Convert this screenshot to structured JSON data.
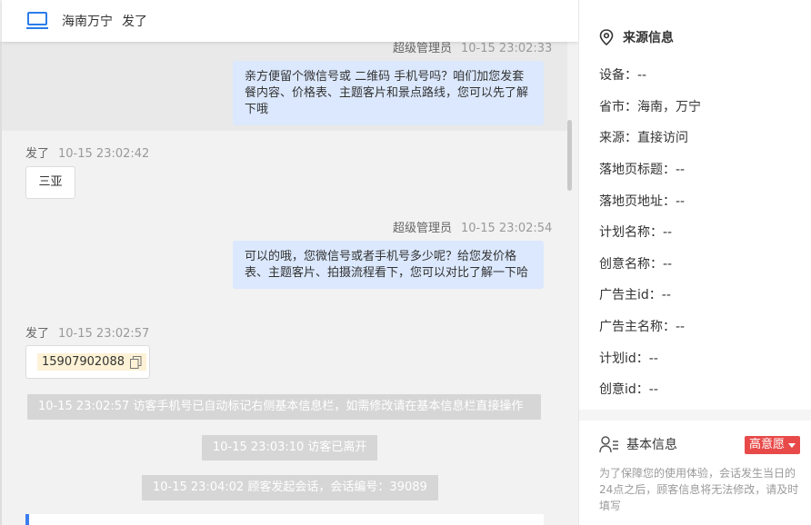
{
  "header": {
    "location": "海南万宁",
    "nickname": "发了"
  },
  "messages": [
    {
      "sender": "超级管理员",
      "time": "10-15 23:02:33",
      "side": "right",
      "text": "亲方便留个微信号或 二维码 手机号吗？咱们加您发套餐内容、价格表、主题客片和景点路线，您可以先了解下哦"
    },
    {
      "sender": "发了",
      "time": "10-15 23:02:42",
      "side": "left",
      "text": "三亚"
    },
    {
      "sender": "超级管理员",
      "time": "10-15 23:02:54",
      "side": "right",
      "text": "可以的哦，您微信号或者手机号多少呢？给您发价格表、主题客片、拍摄流程看下，您可以对比了解一下哈"
    },
    {
      "sender": "发了",
      "time": "10-15 23:02:57",
      "side": "left",
      "text": "15907902088"
    }
  ],
  "system_notices": [
    "10-15 23:02:57 访客手机号已自动标记右侧基本信息栏，如需修改请在基本信息栏直接操作",
    "10-15 23:03:10 访客已离开",
    "10-15 23:04:02 顾客发起会话，会话编号：39089"
  ],
  "source_info": {
    "title": "来源信息",
    "fields": [
      "设备：--",
      "省市：海南，万宁",
      "来源：直接访问",
      "落地页标题：--",
      "落地页地址：--",
      "计划名称：--",
      "创意名称：--",
      "广告主id：--",
      "广告主名称：--",
      "计划id：--",
      "创意id：--"
    ]
  },
  "basic_info": {
    "title": "基本信息",
    "intent_tag": "高意愿",
    "note": "为了保障您的使用体验，会话发生当日的24点之后，顾客信息将无法修改，请及时填写"
  },
  "colors": {
    "accent": "#3b7cf0",
    "bubble": "#dbe8fd",
    "tag": "#e84a4a"
  },
  "icons": {
    "header": "laptop-icon",
    "source": "location-pin-icon",
    "basic": "user-list-icon",
    "copy": "copy-icon"
  }
}
